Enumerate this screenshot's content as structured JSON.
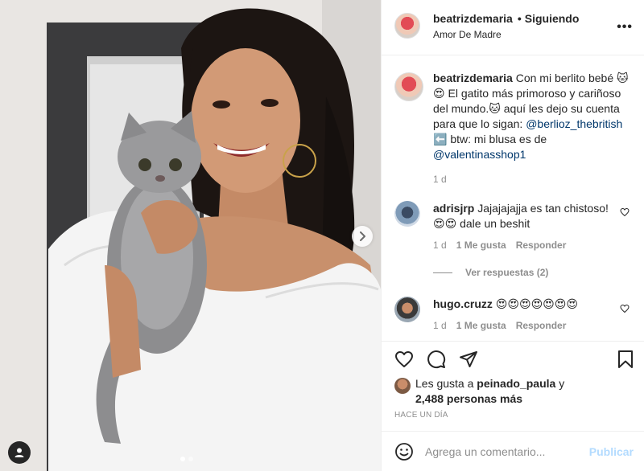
{
  "post": {
    "photo_alt": "",
    "carousel": {
      "count": 2,
      "active": 0
    }
  },
  "header": {
    "username": "beatrizdemaria",
    "bullet": "•",
    "follow_status": "Siguiendo",
    "location": "Amor De Madre",
    "more_icon": "more-options-icon"
  },
  "caption": {
    "username": "beatrizdemaria",
    "text_1": " Con mi berlito bebé 🐱😍 El gatito más primoroso y cariñoso del mundo.🐱 aquí les dejo su cuenta para que lo sigan: ",
    "mention_1": "@berlioz_thebritish",
    "text_2": " ⬅️ btw: mi blusa es de ",
    "mention_2": "@valentinasshop1",
    "time": "1 d"
  },
  "comments": [
    {
      "username": "adrisjrp",
      "text": " Jajajajajja es tan chistoso! 😍😍 dale un beshit",
      "time": "1 d",
      "likes": "1 Me gusta",
      "reply": "Responder",
      "view_replies": "Ver respuestas (2)"
    },
    {
      "username": "hugo.cruzz",
      "text": " 😍😍😍😍😍😍😍",
      "time": "1 d",
      "likes": "1 Me gusta",
      "reply": "Responder"
    }
  ],
  "likes": {
    "prefix": "Les gusta a ",
    "user": "peinado_paula",
    "mid": " y",
    "count": "2,488 personas más"
  },
  "timestamp": "HACE UN DÍA",
  "add_comment": {
    "placeholder": "Agrega un comentario...",
    "post_label": "Publicar"
  },
  "colors": {
    "text": "#262626",
    "muted": "#8e8e8e",
    "link": "#00376b",
    "publish_disabled": "#b3dbff",
    "border": "#efefef"
  }
}
